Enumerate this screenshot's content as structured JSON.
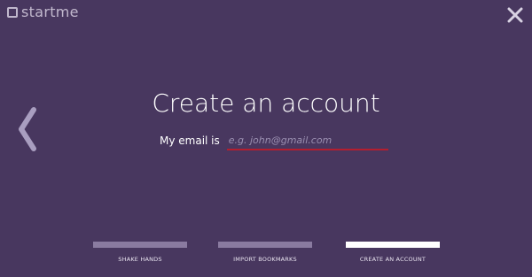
{
  "brand": {
    "name": "startme"
  },
  "header": {
    "close_icon": "close-icon"
  },
  "nav": {
    "back_icon": "chevron-left-icon"
  },
  "main": {
    "title": "Create an account",
    "email_label": "My email is",
    "email_placeholder": "e.g. john@gmail.com",
    "email_value": ""
  },
  "steps": [
    {
      "label": "SHAKE HANDS",
      "active": false
    },
    {
      "label": "IMPORT BOOKMARKS",
      "active": false
    },
    {
      "label": "CREATE AN ACCOUNT",
      "active": true
    }
  ],
  "colors": {
    "background": "#48375f",
    "inactive_step": "#8a7ba0",
    "active_step": "#ffffff",
    "input_underline": "#b41e2f",
    "placeholder": "#9a8fb0"
  }
}
